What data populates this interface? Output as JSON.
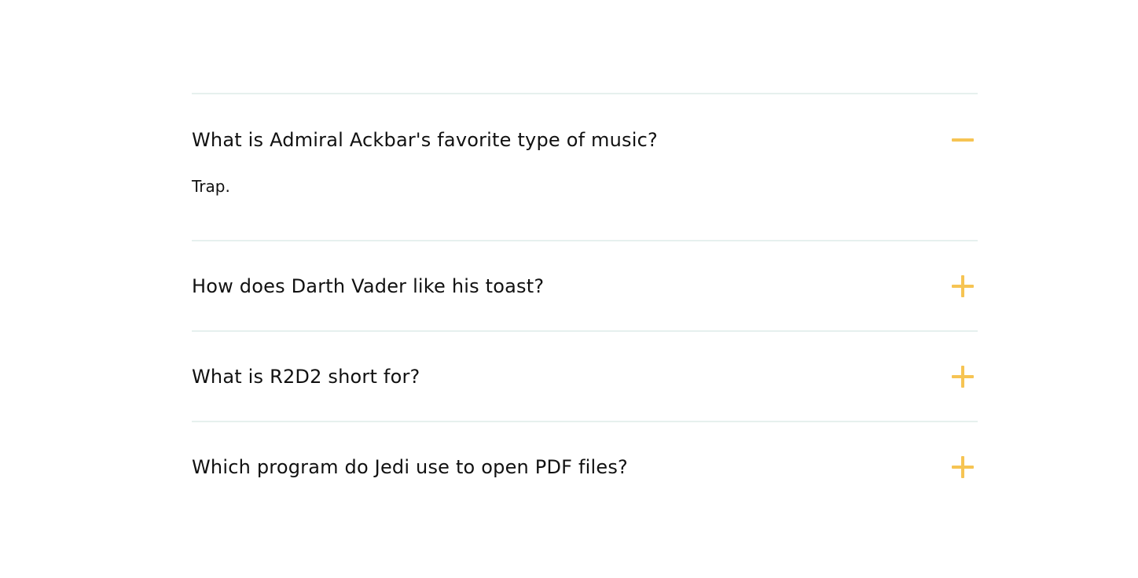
{
  "faq": {
    "items": [
      {
        "question": "What is Admiral Ackbar's favorite type of music?",
        "answer": "Trap.",
        "expanded": true,
        "icon": "minus-icon"
      },
      {
        "question": "How does Darth Vader like his toast?",
        "expanded": false,
        "icon": "plus-icon"
      },
      {
        "question": "What is R2D2 short for?",
        "expanded": false,
        "icon": "plus-icon"
      },
      {
        "question": "Which program do Jedi use to open PDF files?",
        "expanded": false,
        "icon": "plus-icon"
      }
    ]
  },
  "colors": {
    "accent": "#f6c453",
    "divider": "#e6f0ee",
    "text": "#111111"
  }
}
